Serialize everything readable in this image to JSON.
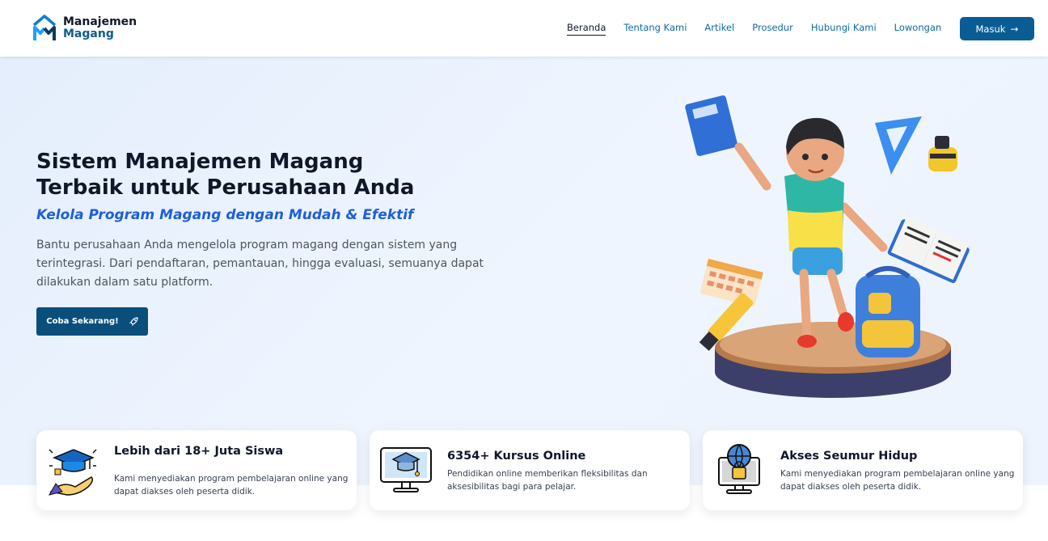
{
  "brand": {
    "line1": "Manajemen",
    "line2": "Magang"
  },
  "nav": {
    "items": [
      "Beranda",
      "Tentang Kami",
      "Artikel",
      "Prosedur",
      "Hubungi Kami",
      "Lowongan"
    ],
    "active": "Beranda",
    "login_label": "Masuk"
  },
  "hero": {
    "title_line1": "Sistem Manajemen Magang",
    "title_line2": "Terbaik untuk Perusahaan Anda",
    "subtitle": "Kelola Program Magang dengan Mudah & Efektif",
    "description": "Bantu perusahaan Anda mengelola program magang dengan sistem yang terintegrasi. Dari pendaftaran, pemantauan, hingga evaluasi, semuanya dapat dilakukan dalam satu platform.",
    "cta_label": "Coba Sekarang!"
  },
  "features": [
    {
      "icon": "graduation-hand-icon",
      "title": "Lebih dari 18+ Juta Siswa",
      "desc": "Kami menyediakan program pembelajaran online yang dapat diakses oleh peserta didik."
    },
    {
      "icon": "monitor-graduation-icon",
      "title": "6354+ Kursus Online",
      "desc": "Pendidikan online memberikan fleksibilitas dan aksesibilitas bagi para pelajar."
    },
    {
      "icon": "globe-lock-monitor-icon",
      "title": "Akses Seumur Hidup",
      "desc": "Kami menyediakan program pembelajaran online yang dapat diakses oleh peserta didik."
    }
  ],
  "colors": {
    "primary": "#0a5c94",
    "accent": "#1d5fd8",
    "title": "#0f172a"
  }
}
